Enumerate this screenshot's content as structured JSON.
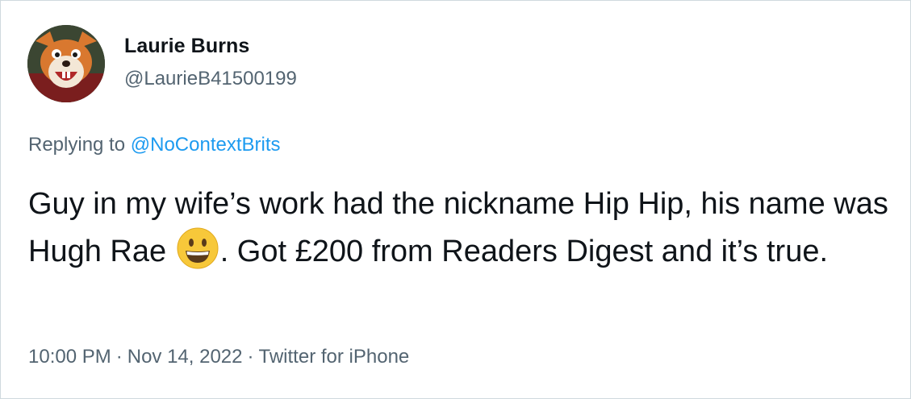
{
  "user": {
    "display_name": "Laurie Burns",
    "handle": "@LaurieB41500199",
    "avatar_icon": "fox-puppet-avatar"
  },
  "reply": {
    "prefix": "Replying to",
    "mention": "@NoContextBrits"
  },
  "tweet": {
    "text_part1": "Guy in my wife’s work had the nickname Hip Hip, his name was Hugh Rae",
    "emoji_icon": "grinning-face-icon",
    "text_part2": ". Got £200 from Readers Digest and it’s true."
  },
  "meta": {
    "time": "10:00 PM",
    "date": "Nov 14, 2022",
    "source": "Twitter for iPhone",
    "separator": "·"
  },
  "colors": {
    "text_primary": "#0f1419",
    "text_secondary": "#536471",
    "link": "#1d9bf0",
    "border": "#cfd9de"
  }
}
